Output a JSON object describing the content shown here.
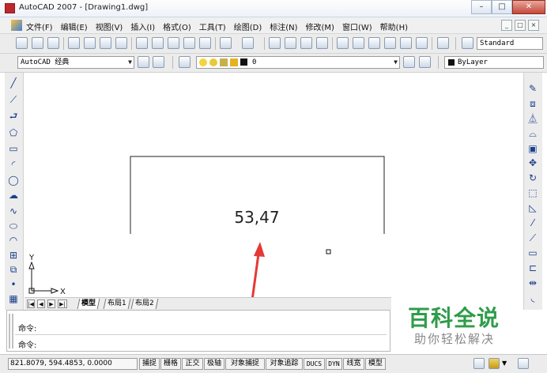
{
  "window": {
    "title": "AutoCAD 2007 - [Drawing1.dwg]",
    "controls": [
      "–",
      "□",
      "✕"
    ],
    "doc_controls": [
      "_",
      "□",
      "×"
    ]
  },
  "menu": {
    "items": [
      "文件(F)",
      "编辑(E)",
      "视图(V)",
      "插入(I)",
      "格式(O)",
      "工具(T)",
      "绘图(D)",
      "标注(N)",
      "修改(M)",
      "窗口(W)",
      "帮助(H)"
    ]
  },
  "toolbar": {
    "text_style": "Standard"
  },
  "properties": {
    "workspace": "AutoCAD 经典",
    "layer": "0",
    "color": "ByLayer"
  },
  "drawing": {
    "dimension_text": "53,47",
    "ucs_x": "X",
    "ucs_y": "Y"
  },
  "layout_tabs": [
    "模型",
    "布局1",
    "布局2"
  ],
  "nav_buttons": [
    "|◀",
    "◀",
    "▶",
    "▶|"
  ],
  "command": {
    "line1": "命令:",
    "line2": "命令:"
  },
  "status": {
    "coordinates": "821.8079, 594.4853, 0.0000",
    "toggles": [
      "捕捉",
      "栅格",
      "正交",
      "极轴",
      "对象捕捉",
      "对象追踪",
      "DUCS",
      "DYN",
      "线宽",
      "模型"
    ]
  },
  "watermark": {
    "main": "百科全说",
    "sub": "助你轻松解决"
  },
  "colors": {
    "annotation_arrow": "#e53935",
    "watermark_green": "#2f9c4a"
  }
}
